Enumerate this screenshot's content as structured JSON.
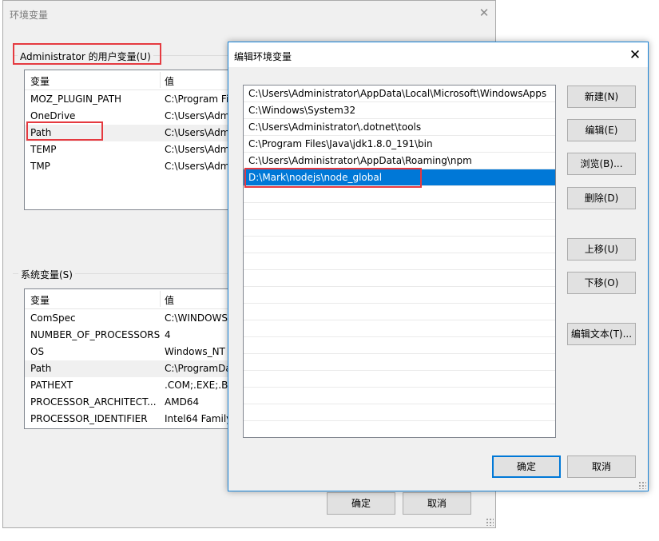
{
  "back_dialog": {
    "title": "环境变量",
    "user_vars": {
      "label": "Administrator 的用户变量(U)",
      "headers": [
        "变量",
        "值"
      ],
      "rows": [
        {
          "name": "MOZ_PLUGIN_PATH",
          "value": "C:\\Program Fi"
        },
        {
          "name": "OneDrive",
          "value": "C:\\Users\\Adm"
        },
        {
          "name": "Path",
          "value": "C:\\Users\\Adm"
        },
        {
          "name": "TEMP",
          "value": "C:\\Users\\Adm"
        },
        {
          "name": "TMP",
          "value": "C:\\Users\\Adm"
        }
      ]
    },
    "system_vars": {
      "label": "系统变量(S)",
      "headers": [
        "变量",
        "值"
      ],
      "rows": [
        {
          "name": "ComSpec",
          "value": "C:\\WINDOWS"
        },
        {
          "name": "NUMBER_OF_PROCESSORS",
          "value": "4"
        },
        {
          "name": "OS",
          "value": "Windows_NT"
        },
        {
          "name": "Path",
          "value": "C:\\ProgramDa"
        },
        {
          "name": "PATHEXT",
          "value": ".COM;.EXE;.BA"
        },
        {
          "name": "PROCESSOR_ARCHITECT...",
          "value": "AMD64"
        },
        {
          "name": "PROCESSOR_IDENTIFIER",
          "value": "Intel64 Family"
        }
      ]
    },
    "ok_label": "确定",
    "cancel_label": "取消"
  },
  "edit_dialog": {
    "title": "编辑环境变量",
    "paths": [
      "C:\\Users\\Administrator\\AppData\\Local\\Microsoft\\WindowsApps",
      "C:\\Windows\\System32",
      "C:\\Users\\Administrator\\.dotnet\\tools",
      "C:\\Program Files\\Java\\jdk1.8.0_191\\bin",
      "C:\\Users\\Administrator\\AppData\\Roaming\\npm",
      "D:\\Mark\\nodejs\\node_global"
    ],
    "selected_index": 5,
    "buttons": {
      "new": "新建(N)",
      "edit": "编辑(E)",
      "browse": "浏览(B)...",
      "delete": "删除(D)",
      "move_up": "上移(U)",
      "move_down": "下移(O)",
      "edit_text": "编辑文本(T)..."
    },
    "ok_label": "确定",
    "cancel_label": "取消"
  },
  "colors": {
    "selection": "#0078d7",
    "annotation_box": "#e53a40",
    "dialog_bg": "#f0f0f0"
  }
}
